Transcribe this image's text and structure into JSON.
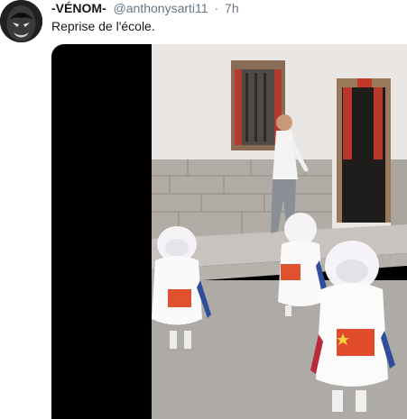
{
  "tweet": {
    "display_name": "-VÉNOM-",
    "handle": "@anthonysarti11",
    "separator": "·",
    "time": "7h",
    "text": "Reprise de l'école.",
    "avatar_icon": "profile-avatar-icon"
  },
  "colors": {
    "name": "#14171a",
    "secondary_text": "#657786",
    "video_bg": "#000000"
  }
}
